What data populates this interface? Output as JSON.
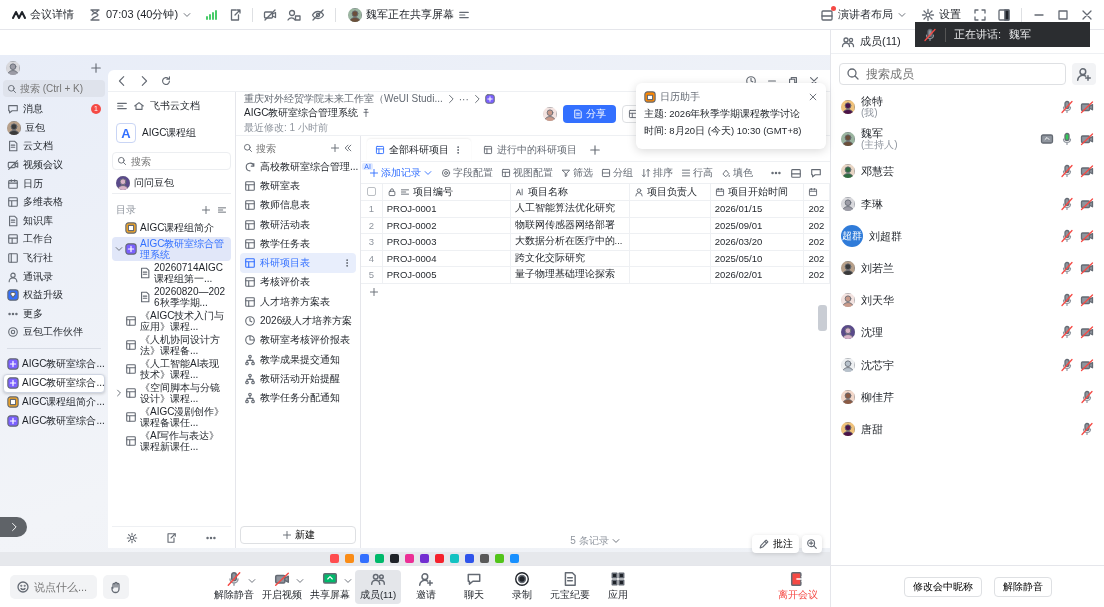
{
  "top_bar": {
    "meeting_info": "会议详情",
    "timer": "07:03 (40分钟)",
    "sharing_notice": "魏军正在共享屏幕",
    "layout": "演讲者布局",
    "settings": "设置"
  },
  "speaking_indicator": {
    "label": "正在讲话:",
    "name": "魏军"
  },
  "shared_screen": {
    "sidebar": {
      "search_placeholder": "搜索 (Ctrl + K)",
      "items": [
        {
          "label": "消息",
          "badge": "1"
        },
        {
          "label": "豆包"
        },
        {
          "label": "云文档"
        },
        {
          "label": "视频会议"
        },
        {
          "label": "日历"
        },
        {
          "label": "多维表格"
        },
        {
          "label": "知识库"
        },
        {
          "label": "工作台"
        },
        {
          "label": "飞行社"
        },
        {
          "label": "通讯录"
        },
        {
          "label": "权益升级"
        },
        {
          "label": "更多"
        },
        {
          "label": "豆包工作伙伴"
        }
      ],
      "recent": [
        {
          "label": "AIGC教研室综合...",
          "kind": "base",
          "selected": false
        },
        {
          "label": "AIGC教研室综合...",
          "kind": "base",
          "selected": true
        },
        {
          "label": "AIGC课程组简介...",
          "kind": "intro",
          "selected": false
        },
        {
          "label": "AIGC教研室综合...",
          "kind": "base",
          "selected": false
        }
      ]
    },
    "docs": {
      "title": "飞书云文档",
      "space_badge": "A",
      "space": "AIGC课程组",
      "search_placeholder": "搜索",
      "assistant": "问问豆包",
      "section": "目录",
      "items": [
        {
          "label": "AIGC课程组简介",
          "kind": "intro",
          "selected": false
        },
        {
          "label": "AIGC教研室综合管理系统",
          "kind": "base",
          "selected": true,
          "expanded": true,
          "children": [
            {
              "label": "20260714AIGC课程组第一...",
              "kind": "doc",
              "selected": false
            },
            {
              "label": "20260820—2026秋季学期...",
              "kind": "doc",
              "selected": false
            }
          ]
        },
        {
          "label": "《AIGC技术入门与应用》课程...",
          "kind": "sheet",
          "selected": false
        },
        {
          "label": "《人机协同设计方法》课程备...",
          "kind": "sheet",
          "selected": false
        },
        {
          "label": "《人工智能AI表现技术》课程...",
          "kind": "sheet",
          "selected": false
        },
        {
          "label": "《空间脚本与分镜设计》课程...",
          "kind": "sheet",
          "selected": false,
          "expanded": false
        },
        {
          "label": "《AIGC漫剧创作》课程备课任...",
          "kind": "sheet",
          "selected": false
        },
        {
          "label": "《AI写作与表达》课程新课任...",
          "kind": "sheet",
          "selected": false
        }
      ]
    },
    "base": {
      "breadcrumb": "重庆对外经贸学院未来工作室（WeUI Studi...",
      "ellipsis": "···",
      "title": "AIGC教研室综合管理系统",
      "modified": "最近修改: 1 小时前",
      "share": "分享",
      "tables": {
        "search_placeholder": "搜索",
        "new_button": "新建",
        "items": [
          {
            "label": "高校教研室综合管理...",
            "kind": "dashboard",
            "badge": "AI",
            "selected": false
          },
          {
            "label": "教研室表",
            "kind": "table",
            "selected": false
          },
          {
            "label": "教师信息表",
            "kind": "table",
            "selected": false
          },
          {
            "label": "教研活动表",
            "kind": "table",
            "selected": false
          },
          {
            "label": "教学任务表",
            "kind": "table",
            "selected": false
          },
          {
            "label": "科研项目表",
            "kind": "table",
            "selected": true
          },
          {
            "label": "考核评价表",
            "kind": "table",
            "selected": false
          },
          {
            "label": "人才培养方案表",
            "kind": "table",
            "selected": false
          },
          {
            "label": "2026级人才培养方案",
            "kind": "doc",
            "selected": false
          },
          {
            "label": "教研室考核评价报表",
            "kind": "report",
            "selected": false
          },
          {
            "label": "教学成果提交通知",
            "kind": "workflow",
            "selected": false
          },
          {
            "label": "教研活动开始提醒",
            "kind": "workflow",
            "selected": false
          },
          {
            "label": "教学任务分配通知",
            "kind": "workflow",
            "selected": false
          }
        ]
      },
      "views": [
        {
          "label": "全部科研项目",
          "selected": true
        },
        {
          "label": "进行中的科研项目",
          "selected": false
        }
      ],
      "toolbar": [
        {
          "label": "添加记录",
          "kind": "add"
        },
        {
          "label": "字段配置",
          "kind": "fields"
        },
        {
          "label": "视图配置",
          "kind": "view"
        },
        {
          "label": "筛选",
          "kind": "filter"
        },
        {
          "label": "分组",
          "kind": "group"
        },
        {
          "label": "排序",
          "kind": "sort"
        },
        {
          "label": "行高",
          "kind": "height"
        },
        {
          "label": "填色",
          "kind": "fill"
        }
      ],
      "table": {
        "all_selected": false,
        "columns": [
          {
            "label": "项目编号",
            "kind": "id"
          },
          {
            "label": "项目名称",
            "kind": "ai"
          },
          {
            "label": "项目负责人",
            "kind": "person"
          },
          {
            "label": "项目开始时间",
            "kind": "date"
          },
          {
            "kind": "date"
          }
        ],
        "rows": [
          {
            "index": "1",
            "project_id": "PROJ-0001",
            "project_name": "人工智能算法优化研究",
            "start_date": "2026/01/15",
            "column_6": "202"
          },
          {
            "index": "2",
            "project_id": "PROJ-0002",
            "project_name": "物联网传感器网络部署",
            "start_date": "2025/09/01",
            "column_6": "202"
          },
          {
            "index": "3",
            "project_id": "PROJ-0003",
            "project_name": "大数据分析在医疗中的...",
            "start_date": "2026/03/20",
            "column_6": "202"
          },
          {
            "index": "4",
            "project_id": "PROJ-0004",
            "project_name": "跨文化交际研究",
            "start_date": "2025/05/10",
            "column_6": "202"
          },
          {
            "index": "5",
            "project_id": "PROJ-0005",
            "project_name": "量子物理基础理论探索",
            "start_date": "2026/02/01",
            "column_6": "202"
          }
        ]
      },
      "record_count": "5 条记录"
    },
    "reminder": {
      "title": "日历助手",
      "topic": "主题: 2026年秋季学期课程教学讨论",
      "time": "时间: 8月20日 (今天) 10:30 (GMT+8)"
    },
    "annotate": "批注"
  },
  "members": {
    "title": "成员(11)",
    "search_placeholder": "搜索成员",
    "items": [
      {
        "name": "徐特",
        "role": "(我)",
        "mic_muted": true,
        "camera_off": true,
        "sharing": false
      },
      {
        "name": "魏军",
        "role": "(主持人)",
        "mic_muted": false,
        "camera_off": true,
        "sharing": true
      },
      {
        "name": "邓慧芸",
        "mic_muted": true,
        "camera_off": true,
        "sharing": false
      },
      {
        "name": "李琳",
        "mic_muted": true,
        "camera_off": true,
        "sharing": false
      },
      {
        "name": "刘超群",
        "avatar_text": "超群",
        "mic_muted": true,
        "camera_off": true,
        "sharing": false
      },
      {
        "name": "刘若兰",
        "mic_muted": true,
        "camera_off": true,
        "sharing": false
      },
      {
        "name": "刘天华",
        "mic_muted": true,
        "camera_off": true,
        "sharing": false
      },
      {
        "name": "沈理",
        "mic_muted": true,
        "camera_off": true,
        "sharing": false
      },
      {
        "name": "沈芯宇",
        "mic_muted": true,
        "camera_off": true,
        "sharing": false
      },
      {
        "name": "柳佳芹",
        "mic_muted": true,
        "camera_off": false,
        "sharing": false
      },
      {
        "name": "唐甜",
        "mic_muted": true,
        "camera_off": false,
        "sharing": false
      }
    ]
  },
  "toolbar": {
    "chat_placeholder": "说点什么...",
    "leave": "离开会议",
    "items": [
      {
        "label": "解除静音",
        "kind": "mic",
        "menu": true,
        "selected": false
      },
      {
        "label": "开启视频",
        "kind": "camera",
        "menu": true,
        "selected": false
      },
      {
        "label": "共享屏幕",
        "kind": "share",
        "menu": true,
        "selected": false
      },
      {
        "label": "成员(11)",
        "kind": "members",
        "menu": false,
        "selected": true
      },
      {
        "label": "邀请",
        "kind": "invite",
        "menu": false,
        "selected": false
      },
      {
        "label": "聊天",
        "kind": "chat",
        "menu": false,
        "selected": false
      },
      {
        "label": "录制",
        "kind": "record",
        "menu": false,
        "selected": false
      },
      {
        "label": "元宝纪要",
        "kind": "notes",
        "menu": false,
        "selected": false
      },
      {
        "label": "应用",
        "kind": "apps",
        "menu": false,
        "selected": false
      }
    ]
  },
  "member_actions": [
    "修改会中昵称",
    "解除静音"
  ]
}
